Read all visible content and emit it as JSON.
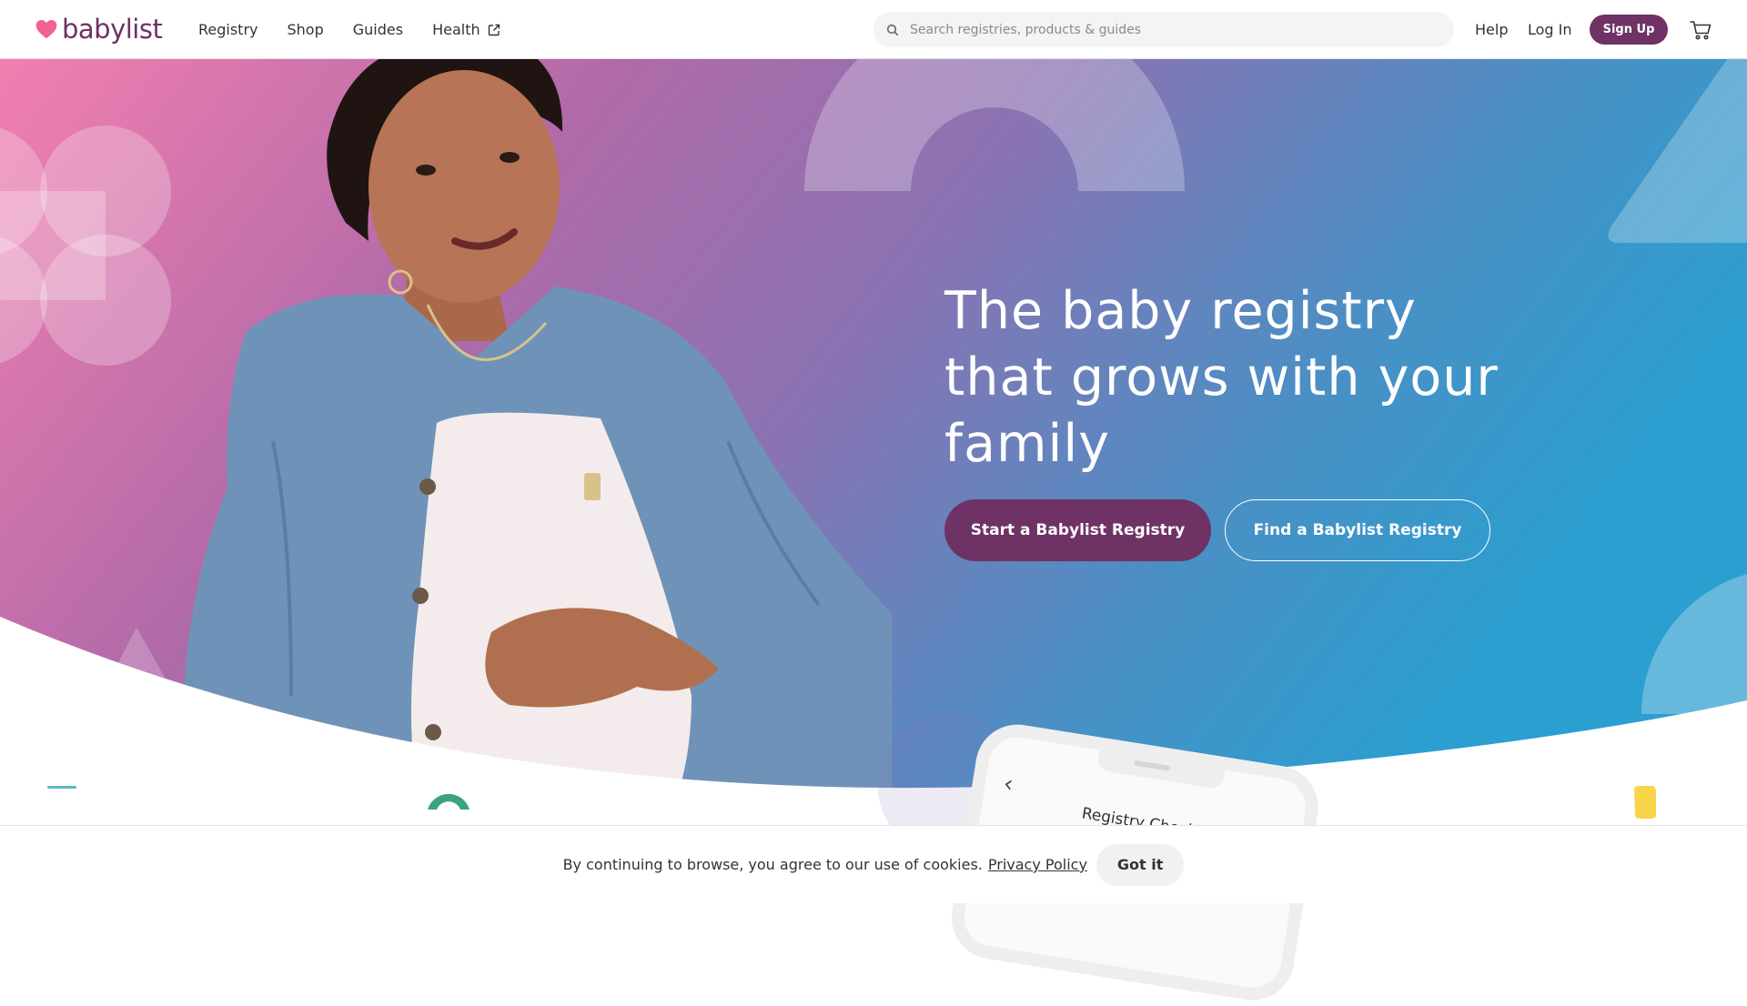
{
  "header": {
    "logo_text": "babylist",
    "nav": [
      {
        "label": "Registry"
      },
      {
        "label": "Shop"
      },
      {
        "label": "Guides"
      },
      {
        "label": "Health"
      }
    ],
    "search_placeholder": "Search registries, products & guides",
    "help_label": "Help",
    "login_label": "Log In",
    "signup_label": "Sign Up"
  },
  "hero": {
    "title": "The baby registry that grows with your family",
    "start_label": "Start a Babylist Registry",
    "find_label": "Find a Babylist Registry"
  },
  "phone": {
    "title": "Registry Checklist"
  },
  "cookie": {
    "text": "By continuing to browse, you agree to our use of cookies.",
    "link": "Privacy Policy",
    "button": "Got it"
  },
  "colors": {
    "brand_plum": "#6e3264",
    "hero_pink": "#f27fb0",
    "hero_purple": "#8a62a6",
    "hero_blue": "#2b9fd0",
    "heart_pink": "#f06292"
  },
  "icons": {
    "logo": "heart-icon",
    "health": "external-link-icon",
    "search": "search-icon",
    "cart": "cart-icon",
    "phone_back": "chevron-left-icon"
  }
}
